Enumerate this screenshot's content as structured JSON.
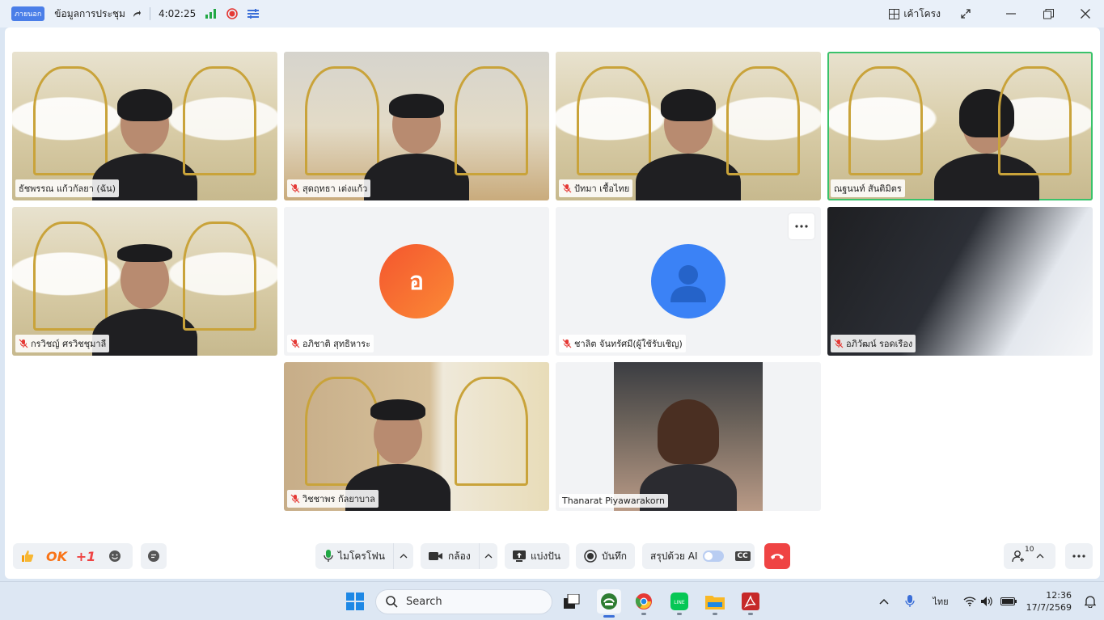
{
  "titlebar": {
    "badge": "ภายนอก",
    "title": "ข้อมูลการประชุม",
    "timer": "4:02:25",
    "layout_label": "เค้าโครง"
  },
  "participants": [
    {
      "name": "ธัชพรรณ แก้วกัลยา (ฉัน)",
      "muted": false
    },
    {
      "name": "สุดฤทธา เต่งแก้ว",
      "muted": true
    },
    {
      "name": "ปัทมา เชื้อไทย",
      "muted": true
    },
    {
      "name": "ณฐนนท์ สันติมิตร",
      "muted": true
    },
    {
      "name": "กรวิชญ์ ศรวิชชุมาลี",
      "muted": true
    },
    {
      "name": "อภิชาติ สุทธิหาระ",
      "muted": true,
      "avatar_letter": "อ"
    },
    {
      "name": "ชาลิต จันทรัศมี(ผู้ใช้รับเชิญ)",
      "muted": true
    },
    {
      "name": "อภิวัฒน์ รอดเรือง",
      "muted": true
    },
    {
      "name": "วิชชาพร กัลยาบาล",
      "muted": true
    },
    {
      "name": "Thanarat Piyawarakorn",
      "muted": false
    }
  ],
  "toolbar": {
    "reaction_ok": "OK",
    "reaction_plus1": "+1",
    "mic_label": "ไมโครโฟน",
    "camera_label": "กล้อง",
    "share_label": "แบ่งปัน",
    "record_label": "บันทึก",
    "ai_summary_label": "สรุปด้วย AI",
    "cc_label": "CC",
    "participants_count": "10"
  },
  "taskbar": {
    "search_placeholder": "Search",
    "language": "ไทย",
    "time": "12:36",
    "date": "17/7/2569"
  },
  "colors": {
    "accent_blue": "#4a7ee8",
    "end_call_red": "#ef4444",
    "active_speaker_green": "#39c26b",
    "avatar_orange": "#f4562f"
  }
}
